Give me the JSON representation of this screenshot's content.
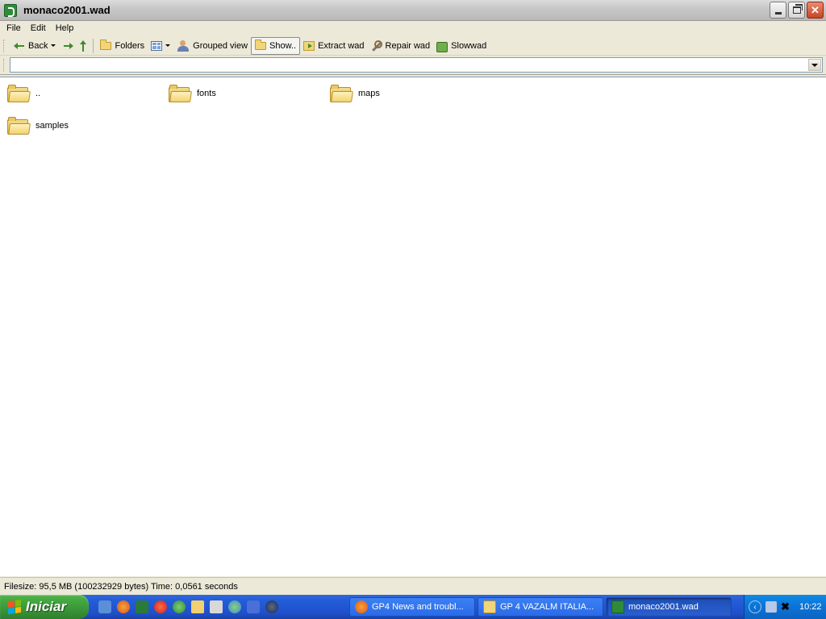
{
  "window": {
    "title": "monaco2001.wad"
  },
  "menu": {
    "items": [
      "File",
      "Edit",
      "Help"
    ]
  },
  "toolbar": {
    "back_label": "Back",
    "folders_label": "Folders",
    "grouped_view_label": "Grouped view",
    "show_label": "Show..",
    "extract_label": "Extract wad",
    "repair_label": "Repair wad",
    "slowwad_label": "Slowwad"
  },
  "address": {
    "value": ""
  },
  "files": [
    {
      "name": ".."
    },
    {
      "name": "fonts"
    },
    {
      "name": "maps"
    },
    {
      "name": "samples"
    }
  ],
  "status": {
    "text": "Filesize: 95,5 MB (100232929 bytes) Time: 0,0561 seconds"
  },
  "taskbar": {
    "start_label": "Iniciar",
    "tasks": [
      {
        "label": "GP4 News and troubl..."
      },
      {
        "label": "GP 4  VAZALM ITALIA..."
      },
      {
        "label": "monaco2001.wad"
      }
    ],
    "clock": "10:22"
  },
  "colors": {
    "taskbar_blue": "#245edb",
    "start_green": "#3c9b3a",
    "folder_yellow": "#f3d36f"
  }
}
